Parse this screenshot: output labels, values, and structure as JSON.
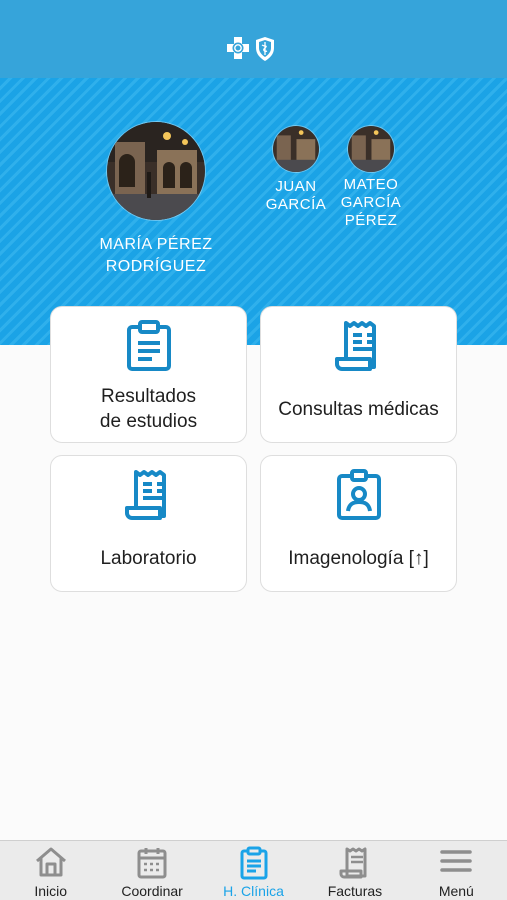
{
  "header": {
    "logo_icon": "bluecross-blueshield-logo-icon"
  },
  "profiles": [
    {
      "name_line1": "MARÍA PÉREZ",
      "name_line2": "RODRÍGUEZ",
      "name_line3": ""
    },
    {
      "name_line1": "JUAN",
      "name_line2": "GARCÍA",
      "name_line3": ""
    },
    {
      "name_line1": "MATEO",
      "name_line2": "GARCÍA",
      "name_line3": "PÉREZ"
    }
  ],
  "cards": [
    {
      "label": "Resultados\nde estudios",
      "icon": "clipboard-icon"
    },
    {
      "label": "Consultas médicas",
      "icon": "receipt-scroll-icon"
    },
    {
      "label": "Laboratorio",
      "icon": "lab-receipt-icon"
    },
    {
      "label": "Imagenología [↑]",
      "icon": "id-badge-icon"
    }
  ],
  "tabs": [
    {
      "label": "Inicio",
      "icon": "home-icon"
    },
    {
      "label": "Coordinar",
      "icon": "calendar-icon"
    },
    {
      "label": "H. Clínica",
      "icon": "clipboard-icon",
      "active": true
    },
    {
      "label": "Facturas",
      "icon": "invoice-icon"
    },
    {
      "label": "Menú",
      "icon": "hamburger-menu-icon"
    }
  ],
  "colors": {
    "accent": "#1aa3e8",
    "topbar": "#36a4da",
    "hero": "#1ba3e6",
    "icon_blue": "#1789c6"
  }
}
